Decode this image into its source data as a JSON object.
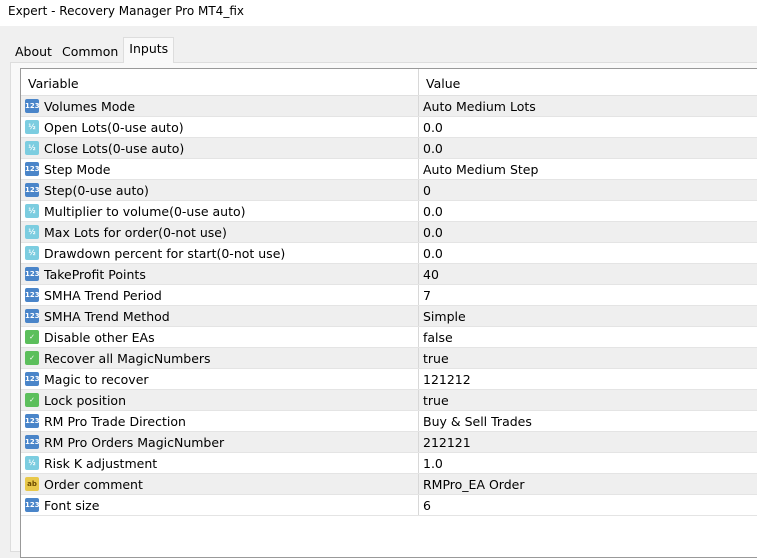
{
  "window": {
    "title": "Expert - Recovery Manager Pro MT4_fix"
  },
  "tabs": [
    "About",
    "Common",
    "Inputs"
  ],
  "table": {
    "headers": [
      "Variable",
      "Value"
    ],
    "rows": [
      {
        "type": "int",
        "icon": "123",
        "name": "Volumes Mode",
        "value": "Auto Medium Lots"
      },
      {
        "type": "dbl",
        "icon": "½",
        "name": "Open Lots(0-use auto)",
        "value": "0.0"
      },
      {
        "type": "dbl",
        "icon": "½",
        "name": "Close Lots(0-use auto)",
        "value": "0.0"
      },
      {
        "type": "int",
        "icon": "123",
        "name": "Step Mode",
        "value": "Auto Medium Step"
      },
      {
        "type": "int",
        "icon": "123",
        "name": "Step(0-use auto)",
        "value": "0"
      },
      {
        "type": "dbl",
        "icon": "½",
        "name": "Multiplier to volume(0-use auto)",
        "value": "0.0"
      },
      {
        "type": "dbl",
        "icon": "½",
        "name": "Max Lots for order(0-not use)",
        "value": "0.0"
      },
      {
        "type": "dbl",
        "icon": "½",
        "name": "Drawdown percent for start(0-not use)",
        "value": "0.0"
      },
      {
        "type": "int",
        "icon": "123",
        "name": "TakeProfit Points",
        "value": "40"
      },
      {
        "type": "int",
        "icon": "123",
        "name": "SMHA Trend Period",
        "value": "7"
      },
      {
        "type": "int",
        "icon": "123",
        "name": "SMHA Trend Method",
        "value": "Simple"
      },
      {
        "type": "bool",
        "icon": "✓",
        "name": "Disable other EAs",
        "value": "false"
      },
      {
        "type": "bool",
        "icon": "✓",
        "name": "Recover all MagicNumbers",
        "value": "true"
      },
      {
        "type": "int",
        "icon": "123",
        "name": "Magic to recover",
        "value": "121212"
      },
      {
        "type": "bool",
        "icon": "✓",
        "name": "Lock position",
        "value": "true"
      },
      {
        "type": "int",
        "icon": "123",
        "name": "RM Pro Trade Direction",
        "value": "Buy & Sell Trades"
      },
      {
        "type": "int",
        "icon": "123",
        "name": "RM Pro Orders MagicNumber",
        "value": "212121"
      },
      {
        "type": "dbl",
        "icon": "½",
        "name": "Risk K adjustment",
        "value": "1.0"
      },
      {
        "type": "str",
        "icon": "ab",
        "name": "Order comment",
        "value": "RMPro_EA Order"
      },
      {
        "type": "int",
        "icon": "123",
        "name": "Font size",
        "value": "6"
      }
    ]
  }
}
